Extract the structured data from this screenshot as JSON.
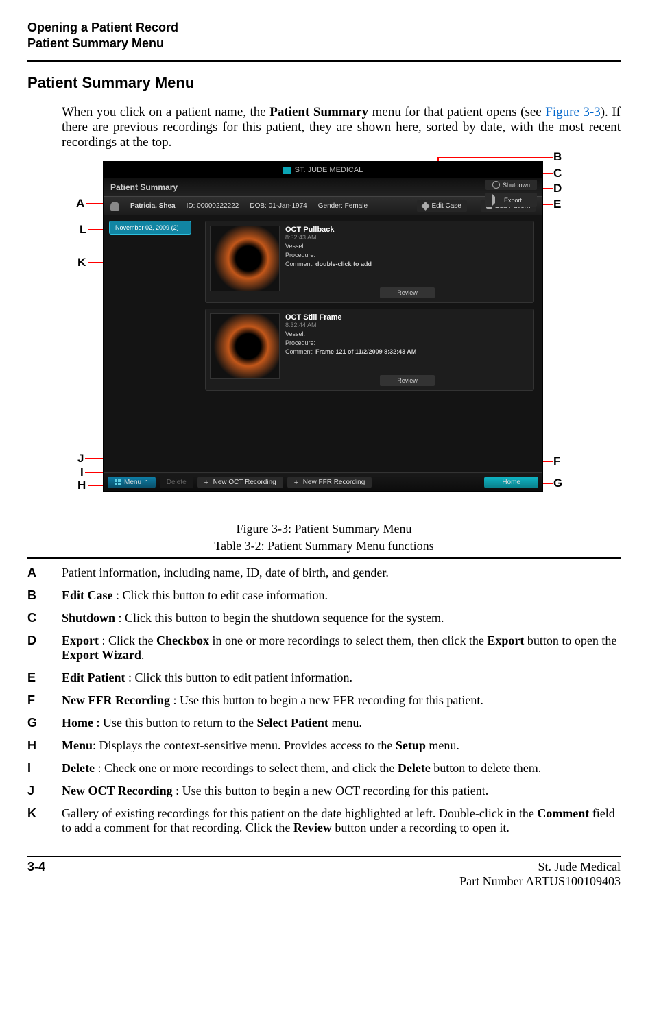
{
  "header": {
    "line1": "Opening a Patient Record",
    "line2": "Patient Summary Menu"
  },
  "section_title": "Patient Summary Menu",
  "intro": {
    "p1a": "When you click on a patient name, the ",
    "p1b": "Patient Summary",
    "p1c": "  menu for that patient opens (see ",
    "p1link": "Figure 3-3",
    "p1d": "). If there are previous recordings for this patient, they are shown here, sorted by date, with the most recent recordings at the top."
  },
  "screenshot": {
    "brand": "ST. JUDE MEDICAL",
    "title": "Patient Summary",
    "shutdown": "Shutdown",
    "export": "Export",
    "patient": {
      "name": "Patricia, Shea",
      "id_label": "ID:",
      "id": "00000222222",
      "dob_label": "DOB:",
      "dob": "01-Jan-1974",
      "gender_label": "Gender:",
      "gender": "Female"
    },
    "edit_case": "Edit Case",
    "edit_patient": "Edit Patient",
    "date_chip": "November 02, 2009",
    "date_count": "(2)",
    "rec1": {
      "title": "OCT Pullback",
      "time": "8:32:43 AM",
      "vessel": "Vessel:",
      "proc": "Procedure:",
      "comment_l": "Comment:",
      "comment_v": "double-click to add",
      "review": "Review"
    },
    "rec2": {
      "title": "OCT Still Frame",
      "time": "8:32:44 AM",
      "vessel": "Vessel:",
      "proc": "Procedure:",
      "comment_l": "Comment:",
      "comment_v": "Frame 121 of 11/2/2009 8:32:43 AM",
      "review": "Review"
    },
    "bottom": {
      "menu": "Menu",
      "delete": "Delete",
      "new_oct": "New OCT Recording",
      "new_ffr": "New FFR Recording",
      "home": "Home"
    }
  },
  "callouts": {
    "A": "A",
    "B": "B",
    "C": "C",
    "D": "D",
    "E": "E",
    "F": "F",
    "G": "G",
    "H": "H",
    "I": "I",
    "J": "J",
    "K": "K",
    "L": "L"
  },
  "fig_caption": "Figure 3-3:  Patient Summary Menu",
  "table_caption": "Table 3-2:  Patient Summary Menu functions",
  "rows": {
    "A": {
      "l": "A",
      "t": "Patient information, including name, ID, date of birth, and gender."
    },
    "B": {
      "l": "B",
      "b": "Edit Case ",
      "t": ": Click this button to edit case information."
    },
    "C": {
      "l": "C",
      "b": "Shutdown ",
      "t": ": Click this button to begin the shutdown sequence for the system."
    },
    "D": {
      "l": "D",
      "b1": "Export ",
      "t1": ": Click the ",
      "b2": "Checkbox",
      "t2": " in one or more recordings to select them, then click the ",
      "b3": "Export",
      "t3": " button to open the ",
      "b4": "Export Wizard",
      "t4": "."
    },
    "E": {
      "l": "E",
      "b": "Edit Patient ",
      "t": ": Click this button to edit patient information."
    },
    "F": {
      "l": "F",
      "b": "New FFR Recording ",
      "t": ": Use this button to begin a new FFR recording for this patient."
    },
    "G": {
      "l": "G",
      "b1": "Home ",
      "t1": ": Use this button to return to the ",
      "b2": "Select Patient",
      "t2": " menu."
    },
    "H": {
      "l": "H",
      "b1": "Menu",
      "t1": ": Displays the context-sensitive menu. Provides access to the ",
      "b2": "Setup",
      "t2": " menu."
    },
    "I": {
      "l": "I",
      "b1": "Delete ",
      "t1": ": Check one or more recordings to select them, and click the ",
      "b2": "Delete",
      "t2": " button to delete them."
    },
    "J": {
      "l": "J",
      "b": "New OCT Recording ",
      "t": ": Use this button to begin a new OCT recording for this patient."
    },
    "K": {
      "l": "K",
      "t1": "Gallery of existing recordings for this patient on the date highlighted at left. Double-click in the ",
      "b1": "Comment",
      "t2": " field to add a comment for that recording. Click the ",
      "b2": "Review",
      "t3": " button under a recording to open it."
    }
  },
  "footer": {
    "page": "3-4",
    "company": "St. Jude Medical",
    "part": "Part Number ARTUS100109403"
  }
}
